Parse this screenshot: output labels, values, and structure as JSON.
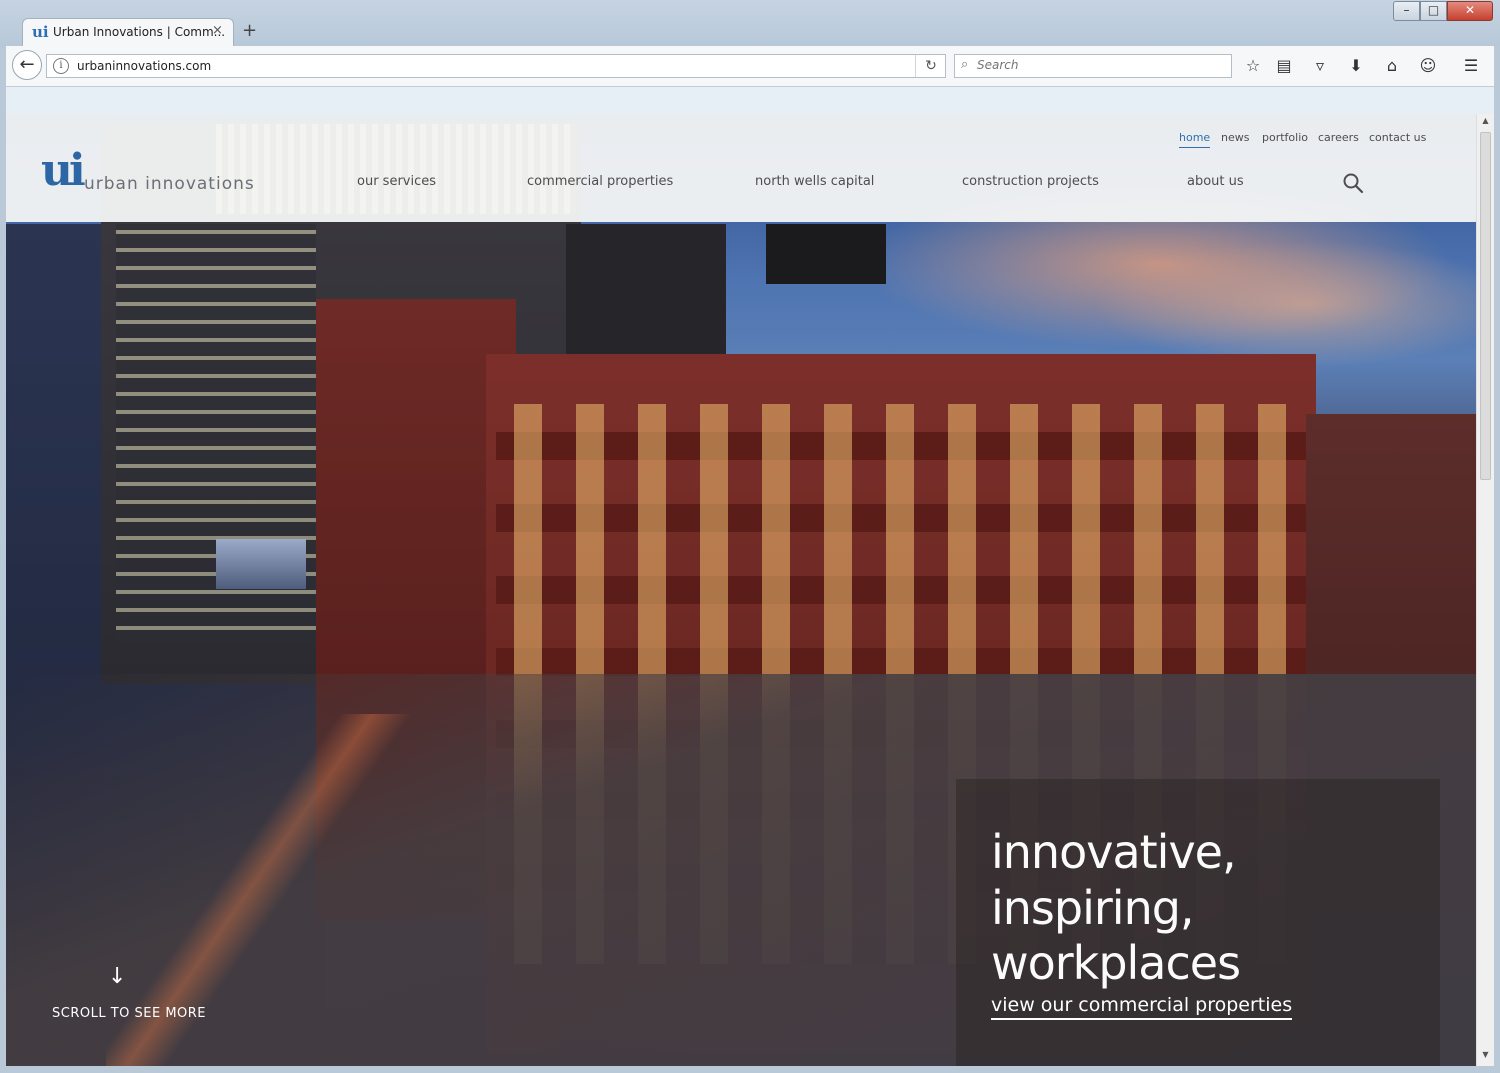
{
  "browser": {
    "tab_title": "Urban Innovations | Comm...",
    "tab_favicon": "ui",
    "tab_close": "×",
    "new_tab": "+",
    "url": "urbaninnovations.com",
    "search_placeholder": "Search",
    "window_controls": {
      "minimize": "–",
      "maximize": "□",
      "close": "✕"
    },
    "toolbar_icons": [
      "back-arrow-icon",
      "info-icon",
      "reload-icon",
      "search-icon",
      "bookmark-star-icon",
      "reading-list-icon",
      "pocket-icon",
      "download-icon",
      "home-icon",
      "chat-icon",
      "menu-icon"
    ]
  },
  "site": {
    "logo_mark": "ui",
    "logo_text": "urban innovations",
    "util_nav": [
      "home",
      "news",
      "portfolio",
      "careers",
      "contact us"
    ],
    "active_util": "home",
    "main_nav": [
      "our services",
      "commercial properties",
      "north wells capital",
      "construction projects",
      "about us"
    ],
    "hero": {
      "tagline_lines": [
        "innovative,",
        "inspiring,",
        "workplaces"
      ],
      "cta": "view our commercial properties",
      "scroll_arrow": "↓",
      "scroll_hint": "SCROLL TO SEE MORE"
    }
  },
  "colors": {
    "brand_blue": "#2c66a4",
    "active_link": "#2f6fb0",
    "nav_text": "#4d4d4d"
  }
}
